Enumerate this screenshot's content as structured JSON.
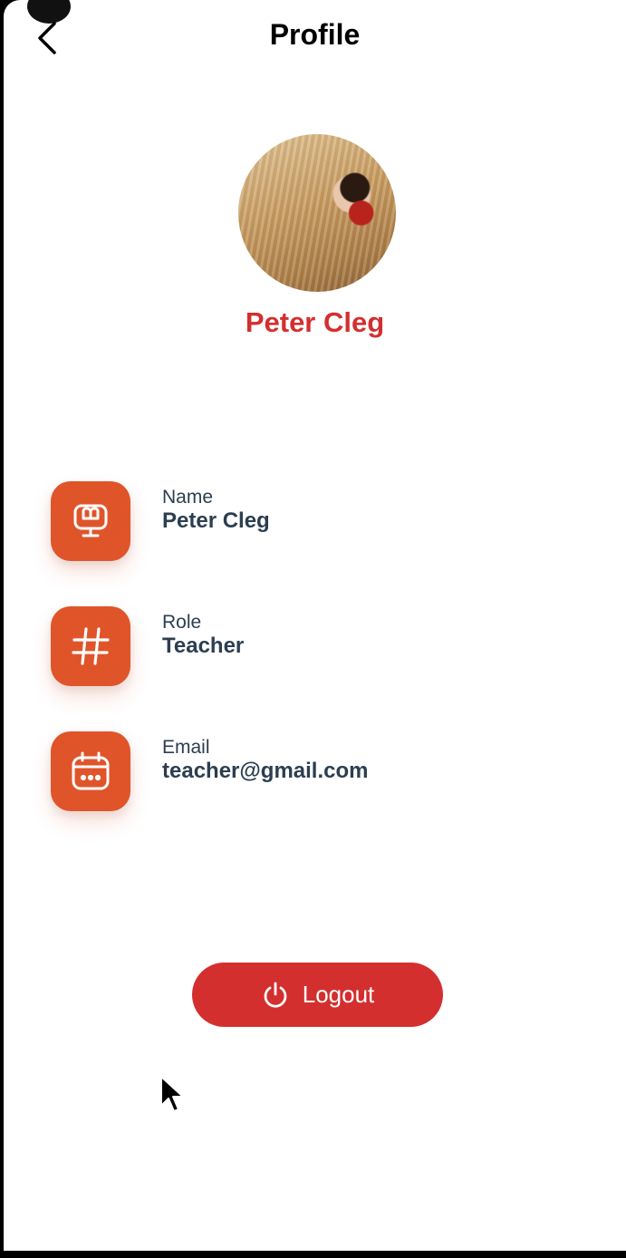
{
  "header": {
    "title": "Profile",
    "back_icon": "chevron-left-icon"
  },
  "profile": {
    "display_name": "Peter Cleg",
    "avatar": "profile-photo"
  },
  "info": [
    {
      "label": "Name",
      "value": "Peter Cleg",
      "icon": "monitor-heart-icon"
    },
    {
      "label": "Role",
      "value": "Teacher",
      "icon": "hash-icon"
    },
    {
      "label": "Email",
      "value": "teacher@gmail.com",
      "icon": "calendar-icon"
    }
  ],
  "logout": {
    "label": "Logout",
    "icon": "power-icon"
  },
  "colors": {
    "accent": "#d32f2f",
    "icon_tile": "#e0542a",
    "text_dark": "#2c3e50"
  }
}
